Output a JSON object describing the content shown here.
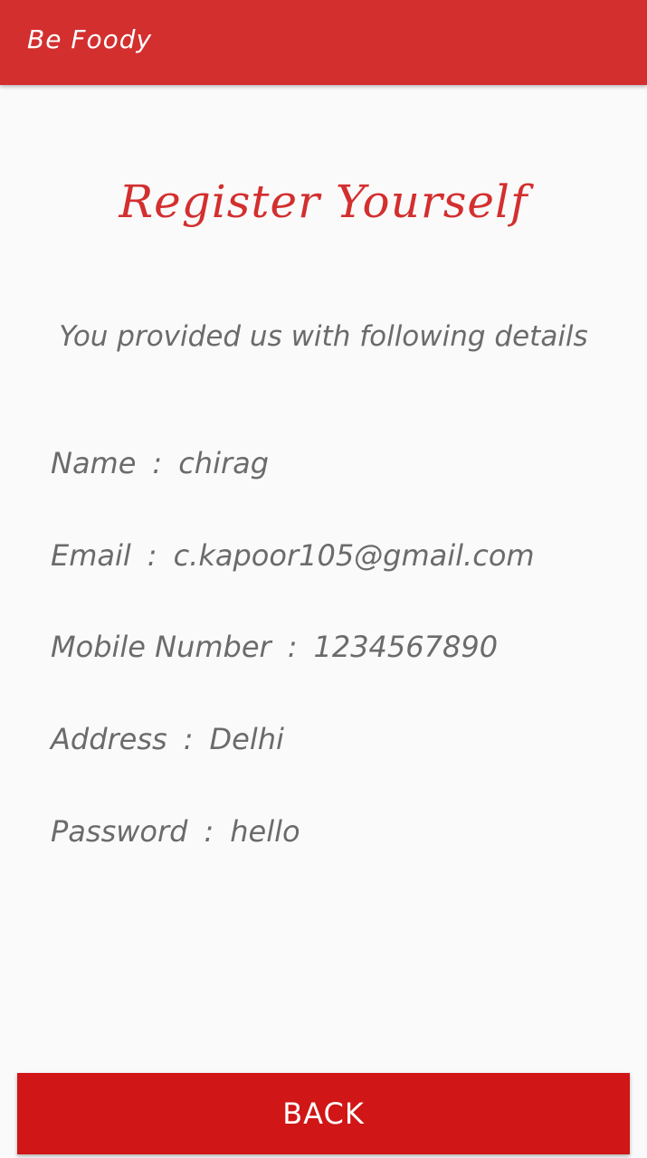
{
  "app_bar": {
    "title": "Be Foody"
  },
  "page": {
    "title": "Register Yourself",
    "subtitle": "You provided us with following details"
  },
  "details": {
    "separator": ":",
    "name": {
      "label": "Name",
      "value": "chirag"
    },
    "email": {
      "label": "Email",
      "value": "c.kapoor105@gmail.com"
    },
    "mobile": {
      "label": "Mobile Number",
      "value": "1234567890"
    },
    "address": {
      "label": "Address",
      "value": "Delhi"
    },
    "password": {
      "label": "Password",
      "value": "hello"
    }
  },
  "actions": {
    "back_label": "BACK"
  },
  "colors": {
    "primary": "#d32f2f",
    "button": "#d01616",
    "text_gray": "#6b6b6b",
    "background": "#fafafa"
  }
}
